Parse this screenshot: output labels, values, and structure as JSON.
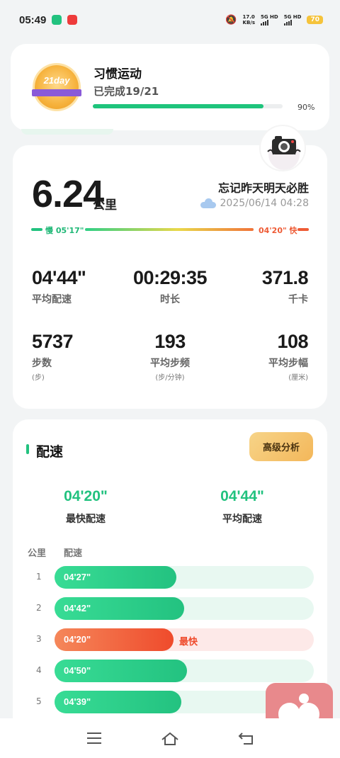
{
  "status_bar": {
    "time": "05:49",
    "speed_value": "17.0",
    "speed_unit": "KB/s",
    "sim1": "5G HD",
    "sim2": "5G HD",
    "battery": "70"
  },
  "habit": {
    "badge_text": "21day",
    "title": "习惯运动",
    "completed": "已完成19/21",
    "progress_percent": 90,
    "progress_label": "90%"
  },
  "run": {
    "distance": "6.24",
    "distance_unit": "公里",
    "motto": "忘记昨天明天必胜",
    "weather_icon": "cloud-icon",
    "datetime": "2025/06/14 04:28",
    "pace_range": {
      "slow": "慢 05'17\"",
      "fast": "04'20\" 快"
    },
    "stats": [
      {
        "value": "04'44\"",
        "label": "平均配速",
        "unit": ""
      },
      {
        "value": "00:29:35",
        "label": "时长",
        "unit": ""
      },
      {
        "value": "371.8",
        "label": "千卡",
        "unit": ""
      },
      {
        "value": "5737",
        "label": "步数",
        "unit": "(步)"
      },
      {
        "value": "193",
        "label": "平均步频",
        "unit": "(步/分钟)"
      },
      {
        "value": "108",
        "label": "平均步幅",
        "unit": "(厘米)"
      }
    ]
  },
  "pace": {
    "title": "配速",
    "advanced_button": "高级分析",
    "fastest_value": "04'20\"",
    "fastest_label": "最快配速",
    "average_value": "04'44\"",
    "average_label": "平均配速",
    "col_km": "公里",
    "col_pace": "配速",
    "fastest_tag": "最快",
    "splits": [
      {
        "km": "1",
        "pace": "04'27\"",
        "fill": 0.47,
        "fastest": false
      },
      {
        "km": "2",
        "pace": "04'42\"",
        "fill": 0.5,
        "fastest": false
      },
      {
        "km": "3",
        "pace": "04'20\"",
        "fill": 0.46,
        "fastest": true
      },
      {
        "km": "4",
        "pace": "04'50\"",
        "fill": 0.51,
        "fastest": false
      },
      {
        "km": "5",
        "pace": "04'39\"",
        "fill": 0.49,
        "fastest": false
      }
    ]
  },
  "colors": {
    "accent_green": "#22c27f",
    "accent_red": "#ef4b2c",
    "advanced_button": "#f3b75a"
  }
}
